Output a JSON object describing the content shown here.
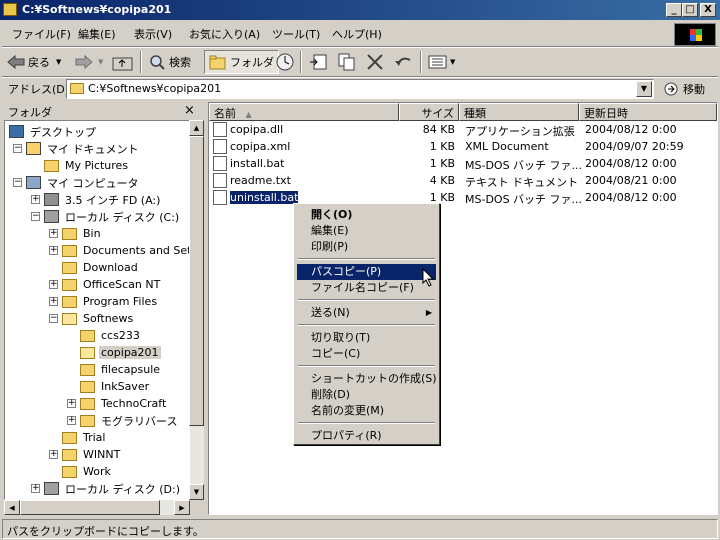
{
  "window": {
    "title": "C:¥Softnews¥copipa201",
    "min_label": "_",
    "max_label": "□",
    "close_label": "X"
  },
  "menubar": [
    {
      "label": "ファイル(F)"
    },
    {
      "label": "編集(E)"
    },
    {
      "label": "表示(V)"
    },
    {
      "label": "お気に入り(A)"
    },
    {
      "label": "ツール(T)"
    },
    {
      "label": "ヘルプ(H)"
    }
  ],
  "toolbar": {
    "back_label": "戻る",
    "search_label": "検索",
    "folders_label": "フォルダ"
  },
  "address": {
    "label": "アドレス(D)",
    "value": "C:¥Softnews¥copipa201",
    "go_label": "移動"
  },
  "folder_pane": {
    "title": "フォルダ",
    "close_label": "×",
    "tree": [
      {
        "label": "デスクトップ",
        "level": 0,
        "exp": "",
        "icon": "desktop-icon"
      },
      {
        "label": "マイ ドキュメント",
        "level": 1,
        "exp": "−",
        "icon": "my-documents-icon"
      },
      {
        "label": "My Pictures",
        "level": 2,
        "exp": "",
        "icon": "folder-icon"
      },
      {
        "label": "マイ コンピュータ",
        "level": 1,
        "exp": "−",
        "icon": "my-computer-icon"
      },
      {
        "label": "3.5 インチ FD (A:)",
        "level": 2,
        "exp": "+",
        "icon": "floppy-drive-icon"
      },
      {
        "label": "ローカル ディスク (C:)",
        "level": 2,
        "exp": "−",
        "icon": "hard-drive-icon"
      },
      {
        "label": "Bin",
        "level": 3,
        "exp": "+",
        "icon": "folder-icon"
      },
      {
        "label": "Documents and Sett",
        "level": 3,
        "exp": "+",
        "icon": "folder-icon"
      },
      {
        "label": "Download",
        "level": 3,
        "exp": "",
        "icon": "folder-icon"
      },
      {
        "label": "OfficeScan NT",
        "level": 3,
        "exp": "+",
        "icon": "folder-icon"
      },
      {
        "label": "Program Files",
        "level": 3,
        "exp": "+",
        "icon": "folder-icon"
      },
      {
        "label": "Softnews",
        "level": 3,
        "exp": "−",
        "icon": "folder-open-icon"
      },
      {
        "label": "ccs233",
        "level": 4,
        "exp": "",
        "icon": "folder-icon"
      },
      {
        "label": "copipa201",
        "level": 4,
        "exp": "",
        "icon": "folder-open-icon",
        "selected": true
      },
      {
        "label": "filecapsule",
        "level": 4,
        "exp": "",
        "icon": "folder-icon"
      },
      {
        "label": "InkSaver",
        "level": 4,
        "exp": "",
        "icon": "folder-icon"
      },
      {
        "label": "TechnoCraft",
        "level": 4,
        "exp": "+",
        "icon": "folder-icon"
      },
      {
        "label": "モグラリバース",
        "level": 4,
        "exp": "+",
        "icon": "folder-icon"
      },
      {
        "label": "Trial",
        "level": 3,
        "exp": "",
        "icon": "folder-icon"
      },
      {
        "label": "WINNT",
        "level": 3,
        "exp": "+",
        "icon": "folder-icon"
      },
      {
        "label": "Work",
        "level": 3,
        "exp": "",
        "icon": "folder-icon"
      },
      {
        "label": "ローカル ディスク (D:)",
        "level": 2,
        "exp": "+",
        "icon": "hard-drive-icon"
      }
    ]
  },
  "columns": {
    "name": "名前",
    "sort_mark": "▲",
    "size": "サイズ",
    "type": "種類",
    "modified": "更新日時"
  },
  "files": [
    {
      "name": "copipa.dll",
      "size": "84 KB",
      "type": "アプリケーション拡張",
      "modified": "2004/08/12 0:00"
    },
    {
      "name": "copipa.xml",
      "size": "1 KB",
      "type": "XML Document",
      "modified": "2004/09/07 20:59"
    },
    {
      "name": "install.bat",
      "size": "1 KB",
      "type": "MS-DOS バッチ ファ...",
      "modified": "2004/08/12 0:00"
    },
    {
      "name": "readme.txt",
      "size": "4 KB",
      "type": "テキスト ドキュメント",
      "modified": "2004/08/21 0:00"
    },
    {
      "name": "uninstall.bat",
      "size": "1 KB",
      "type": "MS-DOS バッチ ファ...",
      "modified": "2004/08/12 0:00",
      "selected": true
    }
  ],
  "context_menu": [
    {
      "label": "開く(O)",
      "bold": true
    },
    {
      "label": "編集(E)"
    },
    {
      "label": "印刷(P)"
    },
    {
      "sep": true
    },
    {
      "label": "パスコピー(P)",
      "highlight": true
    },
    {
      "label": "ファイル名コピー(F)"
    },
    {
      "sep": true
    },
    {
      "label": "送る(N)",
      "submenu": true
    },
    {
      "sep": true
    },
    {
      "label": "切り取り(T)"
    },
    {
      "label": "コピー(C)"
    },
    {
      "sep": true
    },
    {
      "label": "ショートカットの作成(S)"
    },
    {
      "label": "削除(D)"
    },
    {
      "label": "名前の変更(M)"
    },
    {
      "sep": true
    },
    {
      "label": "プロパティ(R)"
    }
  ],
  "status": {
    "text": "パスをクリップボードにコピーします。"
  },
  "colors": {
    "titlebar": "#0a246a",
    "selection": "#0a246a",
    "face": "#d4d0c8"
  }
}
